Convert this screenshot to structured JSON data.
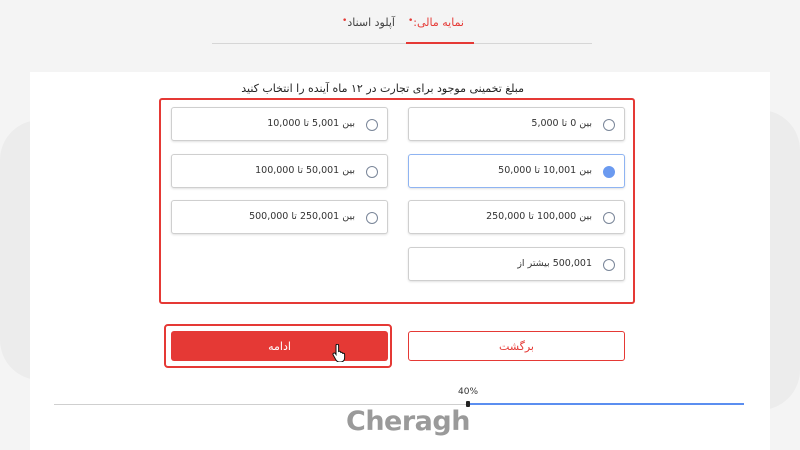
{
  "tabs": {
    "financial": "نمایه مالی:",
    "upload": "آپلود اسناد",
    "required_mark": "•"
  },
  "question": "مبلغ تخمینی موجود برای تجارت در ۱۲ ماه آینده را انتخاب کنید",
  "options": [
    {
      "label": "بین 0 تا 5,000",
      "selected": false
    },
    {
      "label": "بین 5,001 تا 10,000",
      "selected": false
    },
    {
      "label": "بین 10,001 تا 50,000",
      "selected": true
    },
    {
      "label": "بین 50,001 تا 100,000",
      "selected": false
    },
    {
      "label": "بین 100,000 تا 250,000",
      "selected": false
    },
    {
      "label": "بین 250,001 تا 500,000",
      "selected": false
    },
    {
      "label": "500,001 بیشتر از",
      "selected": false
    }
  ],
  "buttons": {
    "back": "برگشت",
    "continue": "ادامه"
  },
  "progress": {
    "label": "40%",
    "value": 0.4
  },
  "watermark": "Cheragh",
  "colors": {
    "accent": "#e53935",
    "selected": "#6b9af0",
    "progress": "#5b8ef0"
  }
}
